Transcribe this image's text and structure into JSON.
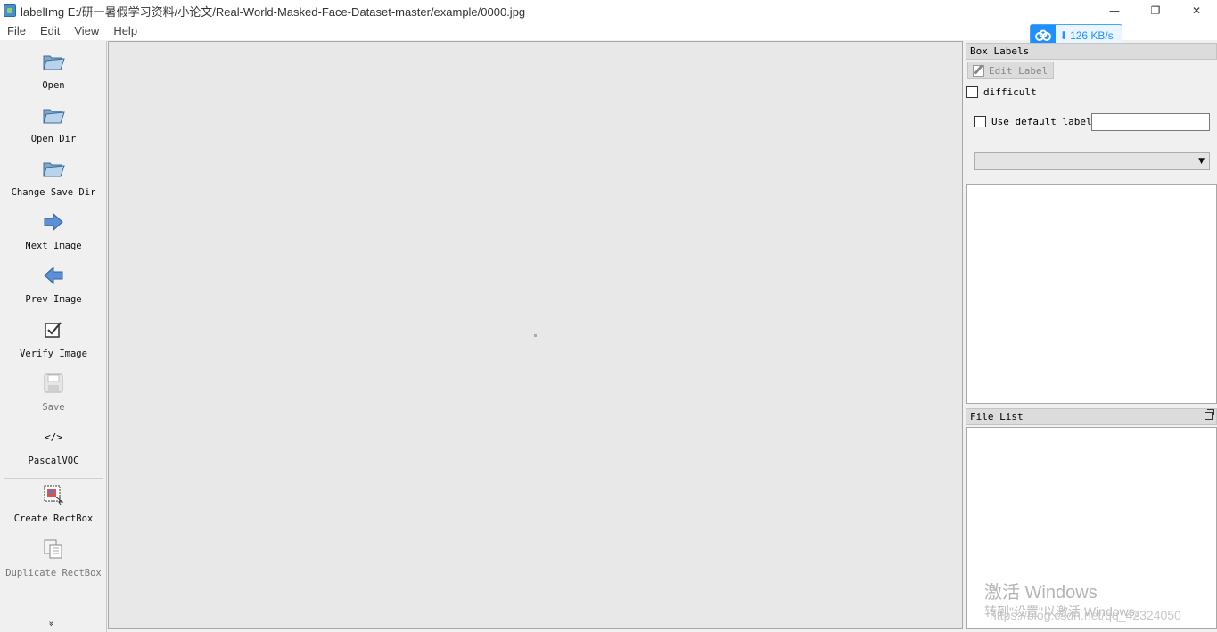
{
  "window": {
    "title": "labelImg E:/研一暑假学习资料/小论文/Real-World-Masked-Face-Dataset-master/example/0000.jpg",
    "minimize": "—",
    "restore": "❐",
    "close": "✕"
  },
  "menu": {
    "items": [
      "File",
      "Edit",
      "View",
      "Help"
    ]
  },
  "speed": {
    "text": "126 KB/s",
    "color": "#1e90ff"
  },
  "toolbar": {
    "items": [
      {
        "label": "Open",
        "icon": "folder-icon",
        "enabled": true
      },
      {
        "label": "Open Dir",
        "icon": "folder-icon",
        "enabled": true
      },
      {
        "label": "Change Save Dir",
        "icon": "folder-icon",
        "enabled": true
      },
      {
        "label": "Next Image",
        "icon": "arrow-right-icon",
        "enabled": true
      },
      {
        "label": "Prev Image",
        "icon": "arrow-left-icon",
        "enabled": true
      },
      {
        "label": "Verify Image",
        "icon": "checkbox-icon",
        "enabled": true
      },
      {
        "label": "Save",
        "icon": "save-icon",
        "enabled": false
      },
      {
        "label": "PascalVOC",
        "icon": "code-icon",
        "enabled": true
      },
      {
        "label": "Create RectBox",
        "icon": "rectbox-icon",
        "enabled": true
      },
      {
        "label": "Duplicate RectBox",
        "icon": "duplicate-icon",
        "enabled": false
      }
    ],
    "more": "»",
    "code_glyph": "</>"
  },
  "box_labels": {
    "title": "Box Labels",
    "edit_label": "Edit Label",
    "difficult": "difficult",
    "use_default_label": "Use default label",
    "default_label_value": "",
    "combo_value": ""
  },
  "file_list": {
    "title": "File List"
  },
  "watermark": {
    "line1": "激活 Windows",
    "line2": "转到\"设置\"以激活 Windows。",
    "line3": "https://blog.csdn.net/qq_42324050"
  }
}
